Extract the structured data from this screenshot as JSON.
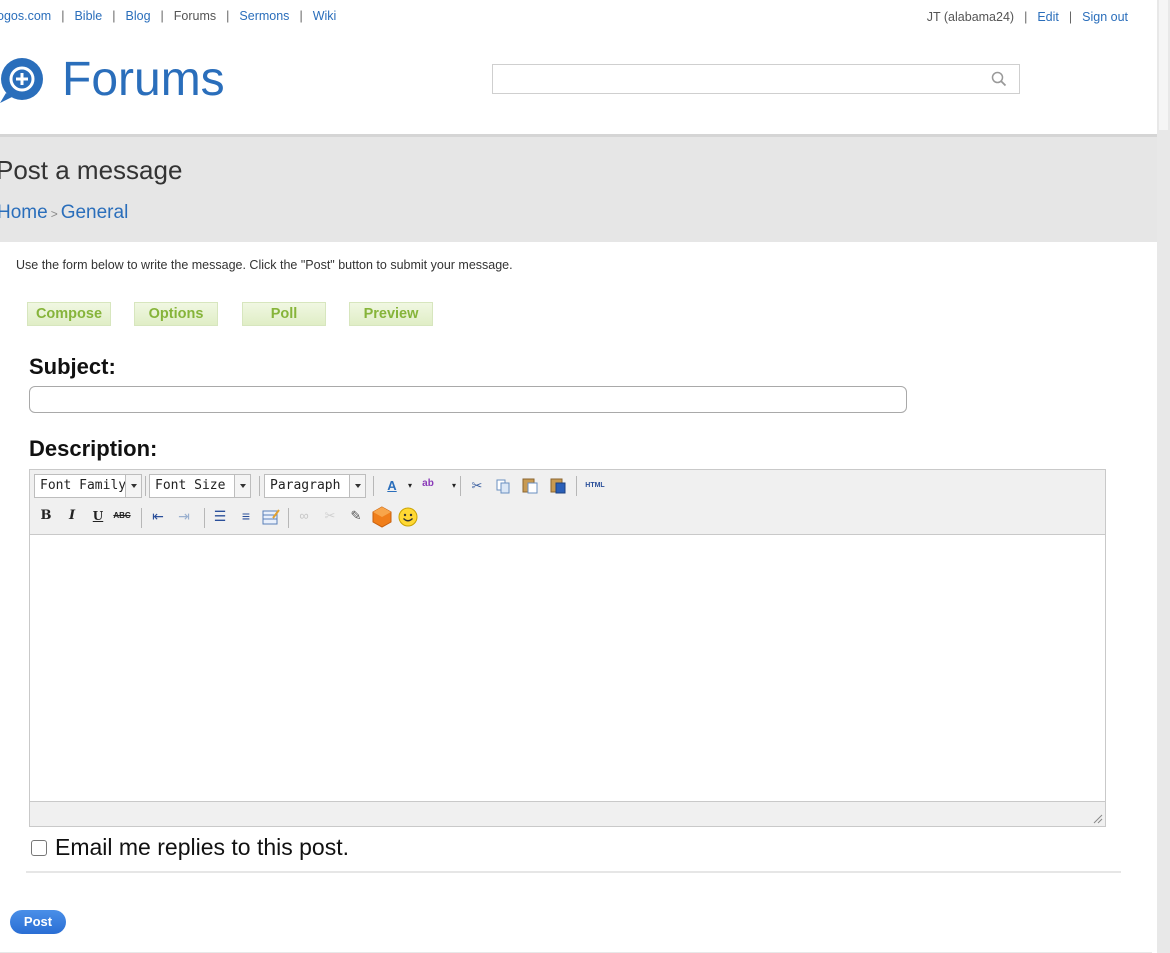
{
  "topnav": {
    "links": [
      "ogos.com",
      "Bible",
      "Blog",
      "Forums",
      "Sermons",
      "Wiki"
    ],
    "user": "JT (alabama24)",
    "edit": "Edit",
    "signout": "Sign out"
  },
  "header": {
    "logo_text": "Forums",
    "search_placeholder": ""
  },
  "page": {
    "title": "Post a message",
    "breadcrumb": [
      "Home",
      "General"
    ],
    "breadcrumb_sep": ">"
  },
  "form": {
    "instructions": "Use the form below to write the message. Click the \"Post\" button to submit your message.",
    "tabs": [
      "Compose",
      "Options",
      "Poll",
      "Preview"
    ],
    "subject_label": "Subject:",
    "subject_value": "",
    "description_label": "Description:",
    "toolbar": {
      "font_family": "Font Family",
      "font_size": "Font Size",
      "block_format": "Paragraph",
      "html_label": "HTML"
    },
    "email_label": "Email me replies to this post.",
    "email_checked": false,
    "post_button": "Post"
  },
  "colors": {
    "link": "#2a6ebb",
    "tab_text": "#86b43a",
    "band": "#e6e6e6",
    "post_button": "#2a6ed4"
  }
}
